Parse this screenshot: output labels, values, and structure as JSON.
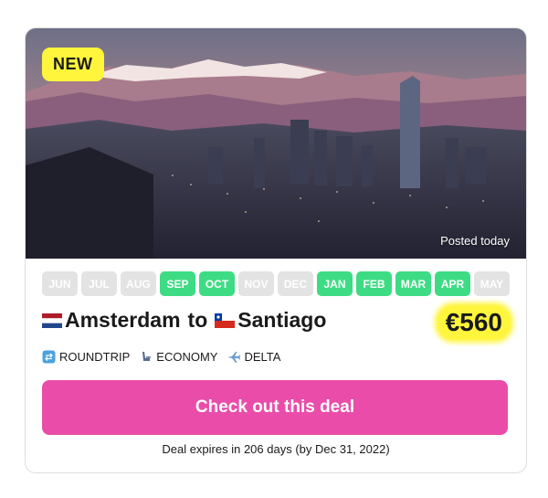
{
  "badge": "NEW",
  "posted": "Posted today",
  "months": [
    {
      "label": "JUN",
      "active": false
    },
    {
      "label": "JUL",
      "active": false
    },
    {
      "label": "AUG",
      "active": false
    },
    {
      "label": "SEP",
      "active": true
    },
    {
      "label": "OCT",
      "active": true
    },
    {
      "label": "NOV",
      "active": false
    },
    {
      "label": "DEC",
      "active": false
    },
    {
      "label": "JAN",
      "active": true
    },
    {
      "label": "FEB",
      "active": true
    },
    {
      "label": "MAR",
      "active": true
    },
    {
      "label": "APR",
      "active": true
    },
    {
      "label": "MAY",
      "active": false
    }
  ],
  "route": {
    "from": "Amsterdam",
    "separator": "to",
    "to": "Santiago",
    "from_flag": "netherlands-flag-icon",
    "to_flag": "chile-flag-icon"
  },
  "price": "€560",
  "tags": [
    {
      "icon": "roundtrip-icon",
      "label": "ROUNDTRIP"
    },
    {
      "icon": "seat-icon",
      "label": "ECONOMY"
    },
    {
      "icon": "airplane-icon",
      "label": "DELTA"
    }
  ],
  "cta": "Check out this deal",
  "expires": "Deal expires in 206 days (by Dec 31, 2022)",
  "colors": {
    "accent": "#e94da9",
    "highlight": "#fff53c",
    "active_month": "#3ddc84",
    "inactive_month": "#e3e3e3"
  }
}
